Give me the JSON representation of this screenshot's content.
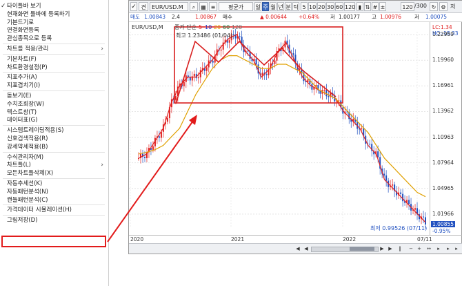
{
  "menu": {
    "items": [
      {
        "label": "타이틀바 보기",
        "checked": true
      },
      {
        "label": "현재화면 툴바에 등록하기"
      },
      {
        "label": "기본드기로"
      },
      {
        "label": "연결화면등록"
      },
      {
        "label": "관심종목으로 등록"
      },
      {
        "sep": true
      },
      {
        "label": "차트를 적용/관리",
        "submenu": true
      },
      {
        "sep": true
      },
      {
        "label": "기본차트(F)"
      },
      {
        "label": "차트환경설정(P)"
      },
      {
        "sep": true
      },
      {
        "label": "지표추가(A)"
      },
      {
        "label": "지표겹치기(I)"
      },
      {
        "sep": true
      },
      {
        "label": "돋보기(E)"
      },
      {
        "label": "수치조회창(W)"
      },
      {
        "label": "텍스트창(T)"
      },
      {
        "label": "데이터표(G)"
      },
      {
        "sep": true
      },
      {
        "label": "시스템트레이딩적용(S)"
      },
      {
        "label": "신호검색적용(R)"
      },
      {
        "label": "강세약세적용(B)"
      },
      {
        "sep": true
      },
      {
        "label": "수식관리자(M)"
      },
      {
        "label": "차트틀(L)",
        "submenu": true
      },
      {
        "label": "모든차트틀삭제(X)"
      },
      {
        "sep": true
      },
      {
        "label": "자동추세선(K)"
      },
      {
        "label": "자동패턴분석(N)",
        "highlighted": true
      },
      {
        "label": "캔들패턴분석(C)"
      },
      {
        "sep": true
      },
      {
        "label": "가격데이터 시뮬레이션(H)"
      },
      {
        "sep": true
      },
      {
        "label": "그림저장(D)"
      }
    ]
  },
  "toolbar": {
    "select_label": "견",
    "symbol": "EUR/USD.M",
    "price_type": "평균가",
    "periods": [
      "일",
      "주",
      "월",
      "년",
      "분",
      "틱"
    ],
    "selected_period": "주",
    "ranges": [
      "5",
      "10",
      "20",
      "30",
      "60",
      "120"
    ],
    "count": "120",
    "count_total": "/300",
    "extra": "저"
  },
  "quote": {
    "sell_label": "매도",
    "sell_value": "1.00843",
    "sell_qty": "2.4",
    "buy_value": "1.00867",
    "buy_label": "매수",
    "change": "▲ 0.00644",
    "change_pct": "+0.64%",
    "low_label": "저",
    "low_value": "1.00177",
    "high_label": "고",
    "high_value": "1.00976",
    "close_label": "저",
    "close_value": "1.00075"
  },
  "chart_overlay": {
    "symbol_label": "EUR/USD,M",
    "ma_label": "종가 단순",
    "ma_periods": [
      "5",
      "10",
      "20",
      "60",
      "120"
    ],
    "ma_colors": [
      "#e02020",
      "#2030c0",
      "#e0a000",
      "#208040",
      "#707070"
    ],
    "high_note": "최고 1.23486 (01/04)",
    "low_note": "최저 0.99526 (07/11)",
    "lc": "LC:1.34",
    "hc": "HC:-18.33",
    "current_price": "1.00855",
    "current_change": "-0.95%"
  },
  "colors": {
    "up": "#e02020",
    "down": "#2050c0",
    "highlight": "#e21b1b",
    "selected_tab": "#3d6cc0"
  },
  "chart_data": {
    "type": "line",
    "title": "",
    "y_ticks": [
      "1.22959",
      "1.19960",
      "1.16961",
      "1.13962",
      "1.10963",
      "1.07964",
      "1.04965",
      "1.01966"
    ],
    "x_ticks": [
      "2020",
      "2021",
      "2022",
      "07/11"
    ],
    "ylim": [
      1.005,
      1.233
    ],
    "series": [
      {
        "name": "5",
        "values": [
          1.085,
          1.09,
          1.105,
          1.12,
          1.15,
          1.17,
          1.18,
          1.18,
          1.19,
          1.2,
          1.215,
          1.225,
          1.23,
          1.21,
          1.2,
          1.18,
          1.19,
          1.21,
          1.22,
          1.2,
          1.18,
          1.17,
          1.165,
          1.16,
          1.155,
          1.14,
          1.13,
          1.12,
          1.1,
          1.09,
          1.06,
          1.05,
          1.04,
          1.03,
          1.02,
          1.01
        ]
      },
      {
        "name": "20",
        "values": [
          1.09,
          1.092,
          1.095,
          1.1,
          1.11,
          1.12,
          1.14,
          1.16,
          1.175,
          1.19,
          1.2,
          1.205,
          1.205,
          1.2,
          1.195,
          1.19,
          1.19,
          1.195,
          1.195,
          1.19,
          1.185,
          1.175,
          1.165,
          1.16,
          1.155,
          1.145,
          1.135,
          1.125,
          1.115,
          1.1,
          1.085,
          1.075,
          1.065,
          1.055,
          1.045,
          1.04
        ]
      }
    ]
  }
}
